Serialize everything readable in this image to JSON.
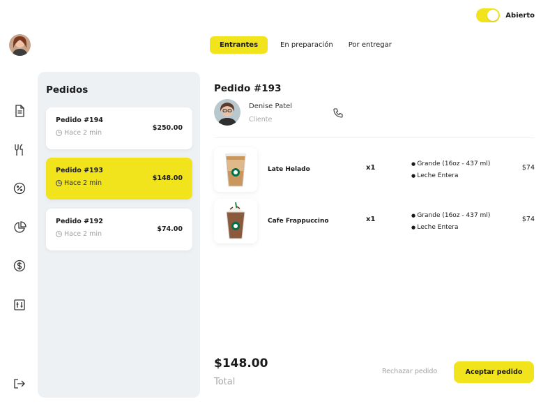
{
  "status_toggle": {
    "label": "Abierto",
    "on": true
  },
  "colors": {
    "accent": "#f2e41c",
    "panel": "#eef1f4",
    "muted": "#a8a8a8"
  },
  "sidebar": {
    "icons": [
      "document-icon",
      "utensils-icon",
      "discount-icon",
      "pie-chart-icon",
      "dollar-icon",
      "settings-sliders-icon",
      "logout-icon"
    ]
  },
  "tabs": [
    {
      "label": "Entrantes",
      "active": true
    },
    {
      "label": "En preparación",
      "active": false
    },
    {
      "label": "Por entregar",
      "active": false
    }
  ],
  "orders": {
    "title": "Pedidos",
    "items": [
      {
        "title": "Pedido #194",
        "time": "Hace 2 min",
        "price": "$250.00",
        "active": false
      },
      {
        "title": "Pedido #193",
        "time": "Hace 2 min",
        "price": "$148.00",
        "active": true
      },
      {
        "title": "Pedido #192",
        "time": "Hace 2 min",
        "price": "$74.00",
        "active": false
      }
    ]
  },
  "detail": {
    "title": "Pedido #193",
    "customer": {
      "name": "Denise Patel",
      "role": "Cliente"
    },
    "items": [
      {
        "name": "Late Helado",
        "qty": "x1",
        "options": [
          "Grande (16oz - 437 ml)",
          "Leche Entera"
        ],
        "price": "$74"
      },
      {
        "name": "Cafe Frappuccino",
        "qty": "x1",
        "options": [
          "Grande (16oz - 437 ml)",
          "Leche Entera"
        ],
        "price": "$74"
      }
    ],
    "total_amount": "$148.00",
    "total_label": "Total",
    "reject_label": "Rechazar pedido",
    "accept_label": "Aceptar pedido"
  }
}
